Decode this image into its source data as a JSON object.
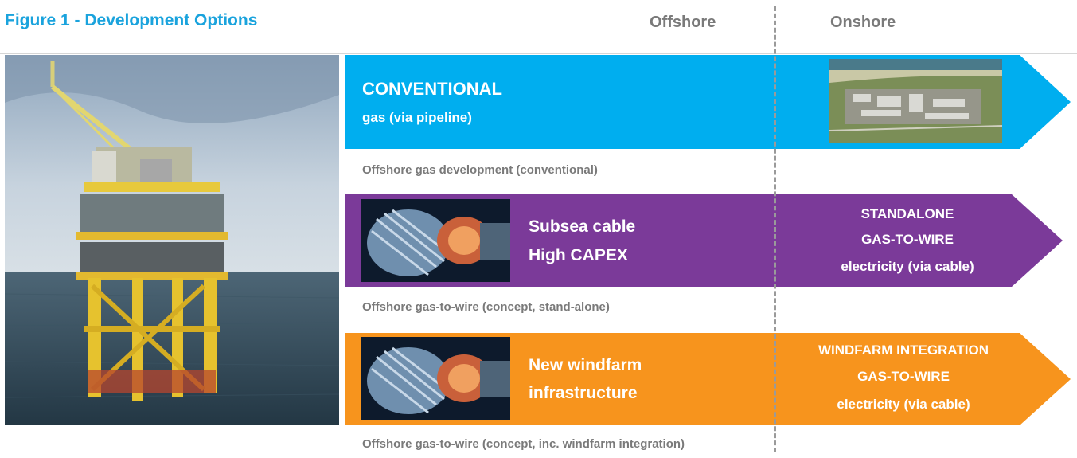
{
  "figure_title": "Figure 1 - Development Options",
  "columns": {
    "offshore": "Offshore",
    "onshore": "Onshore"
  },
  "colors": {
    "blue": "#00aeef",
    "purple": "#7b3a99",
    "orange": "#f7941d",
    "title_blue": "#1aa3dd",
    "gray_text": "#7a7a7a"
  },
  "rows": [
    {
      "title": "CONVENTIONAL",
      "subtitle": "gas (via pipeline)",
      "caption": "Offshore gas development (conventional)",
      "thumb_icon": "onshore-gas-plant-aerial-image"
    },
    {
      "left_line1": "Subsea cable",
      "left_line2": "High CAPEX",
      "right_line1": "STANDALONE",
      "right_line2": "GAS-TO-WIRE",
      "right_line3": "electricity (via cable)",
      "caption": "Offshore gas-to-wire (concept, stand-alone)",
      "thumb_icon": "gas-turbine-image"
    },
    {
      "left_line1": "New windfarm",
      "left_line2": "infrastructure",
      "right_line1": "WINDFARM INTEGRATION",
      "right_line2": "GAS-TO-WIRE",
      "right_line3": "electricity (via cable)",
      "caption": "Offshore gas-to-wire (concept, inc. windfarm integration)",
      "thumb_icon": "gas-turbine-image"
    }
  ],
  "photo_icon": "offshore-platform-photo"
}
